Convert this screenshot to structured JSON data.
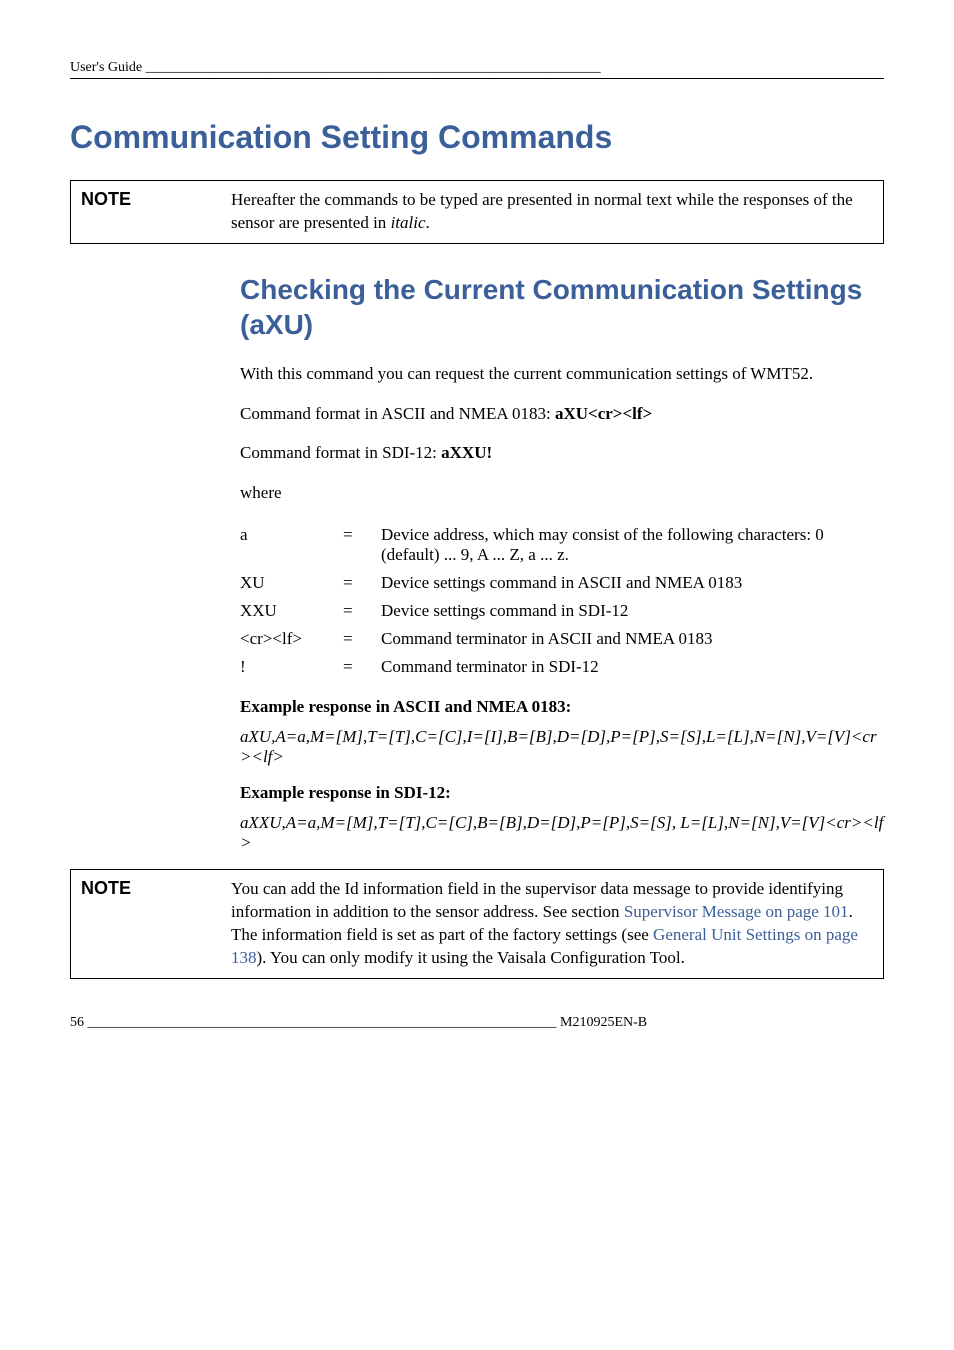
{
  "running_head": "User's Guide _________________________________________________________________",
  "h1": "Communication Setting Commands",
  "note1": {
    "label": "NOTE",
    "body_pre": "Hereafter the commands to be typed are presented in normal text while the responses of the sensor are presented in ",
    "body_ital": "italic",
    "body_post": "."
  },
  "h2": "Checking the Current Communication Settings (aXU)",
  "p1": "With this command you can request the current communication settings of WMT52.",
  "p2_pre": "Command format in ASCII and NMEA 0183: ",
  "p2_bold": "aXU<cr><lf>",
  "p3_pre": "Command format in SDI-12: ",
  "p3_bold": "aXXU!",
  "where_label": "where",
  "where_rows": [
    {
      "k": "a",
      "eq": "=",
      "v": "Device address, which may consist of the following characters: 0 (default) ... 9, A ... Z, a ... z."
    },
    {
      "k": "XU",
      "eq": "=",
      "v": "Device settings command in ASCII and NMEA 0183"
    },
    {
      "k": "XXU",
      "eq": "=",
      "v": "Device settings command in SDI-12"
    },
    {
      "k": "<cr><lf>",
      "eq": "=",
      "v": "Command terminator in ASCII and NMEA 0183"
    },
    {
      "k": "!",
      "eq": "=",
      "v": "Command terminator in SDI-12"
    }
  ],
  "ex1_head": "Example response in ASCII and NMEA 0183:",
  "ex1_body": "aXU,A=a,M=[M],T=[T],C=[C],I=[I],B=[B],D=[D],P=[P],S=[S],L=[L],N=[N],V=[V]<cr><lf>",
  "ex2_head": "Example response in SDI-12:",
  "ex2_body": "aXXU,A=a,M=[M],T=[T],C=[C],B=[B],D=[D],P=[P],S=[S], L=[L],N=[N],V=[V]<cr><lf>",
  "note2": {
    "label": "NOTE",
    "body_1": "You can add the Id information field in the supervisor data message to provide identifying information in addition to the sensor address. See section ",
    "link1": "Supervisor Message on page 101",
    "body_2": ". The information field is set as part of the factory settings (see ",
    "link2": "General Unit Settings on page 138",
    "body_3": "). You can only modify it using the Vaisala Configuration Tool."
  },
  "footer_left": "56 ___________________________________________________________________ ",
  "footer_right": "M210925EN-B"
}
